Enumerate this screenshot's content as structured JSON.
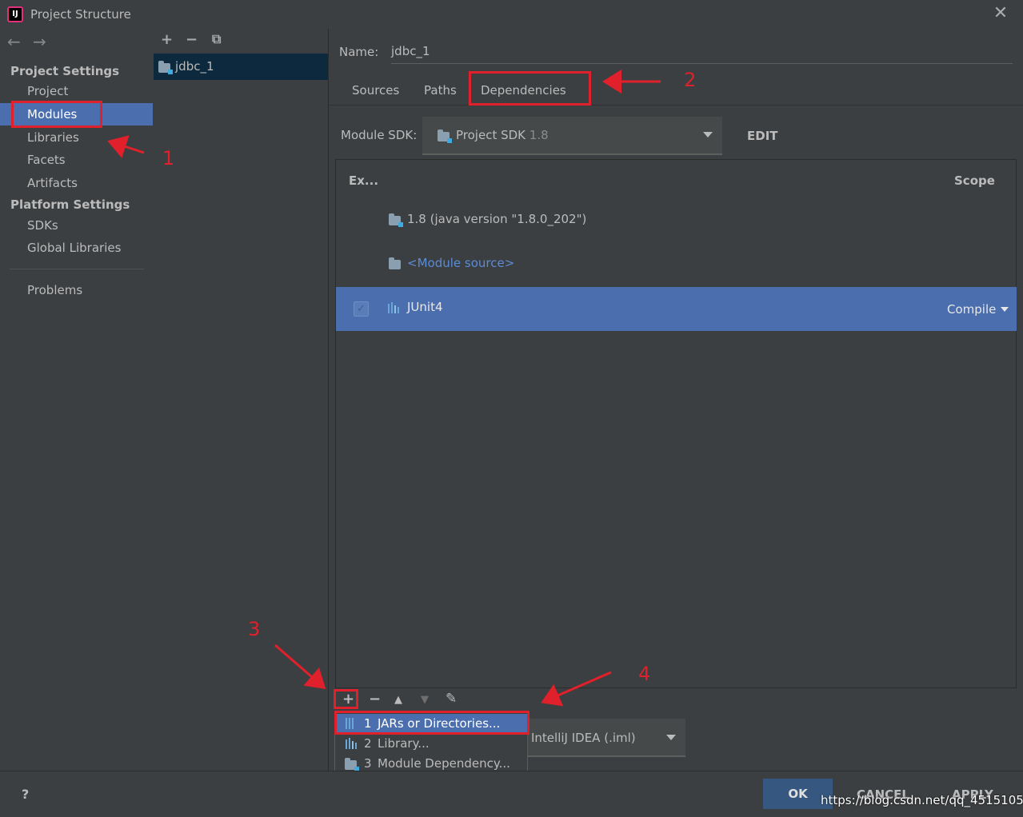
{
  "window": {
    "title": "Project Structure",
    "logo_text": "IJ"
  },
  "sidebar": {
    "project_settings_title": "Project Settings",
    "platform_settings_title": "Platform Settings",
    "items": {
      "project": "Project",
      "modules": "Modules",
      "libraries": "Libraries",
      "facets": "Facets",
      "artifacts": "Artifacts",
      "sdks": "SDKs",
      "global_libraries": "Global Libraries",
      "problems": "Problems"
    },
    "selected": "Modules"
  },
  "modules": {
    "items": [
      "jdbc_1"
    ]
  },
  "detail": {
    "name_label": "Name:",
    "name_value": "jdbc_1",
    "tabs": [
      "Sources",
      "Paths",
      "Dependencies"
    ],
    "active_tab": "Dependencies",
    "sdk_label": "Module SDK:",
    "sdk_value": "Project SDK",
    "sdk_version": "1.8",
    "edit_label": "EDIT"
  },
  "dependencies": {
    "col_export": "Ex...",
    "col_scope": "Scope",
    "rows": [
      {
        "label": "1.8 (java version \"1.8.0_202\")",
        "icon": "jdk-folder-icon"
      },
      {
        "label": "<Module source>",
        "icon": "module-source-folder-icon"
      },
      {
        "label": "JUnit4",
        "icon": "library-icon",
        "scope": "Compile",
        "checked": true,
        "selected": true
      }
    ]
  },
  "format_combo": {
    "value": "IntelliJ IDEA (.iml)"
  },
  "popup": {
    "items": [
      {
        "num": "1",
        "label": "JARs or Directories..."
      },
      {
        "num": "2",
        "label": "Library..."
      },
      {
        "num": "3",
        "label": "Module Dependency..."
      }
    ]
  },
  "footer": {
    "help": "?",
    "ok": "OK",
    "cancel": "CANCEL",
    "apply": "APPLY"
  },
  "annotations": {
    "labels": [
      "1",
      "2",
      "3",
      "4"
    ],
    "color": "#e0202a"
  },
  "watermark": "https://blog.csdn.net/qq_45151059",
  "colors": {
    "background": "#3c3f41",
    "selection": "#4b6eaf",
    "accent_red": "#e0202a"
  }
}
